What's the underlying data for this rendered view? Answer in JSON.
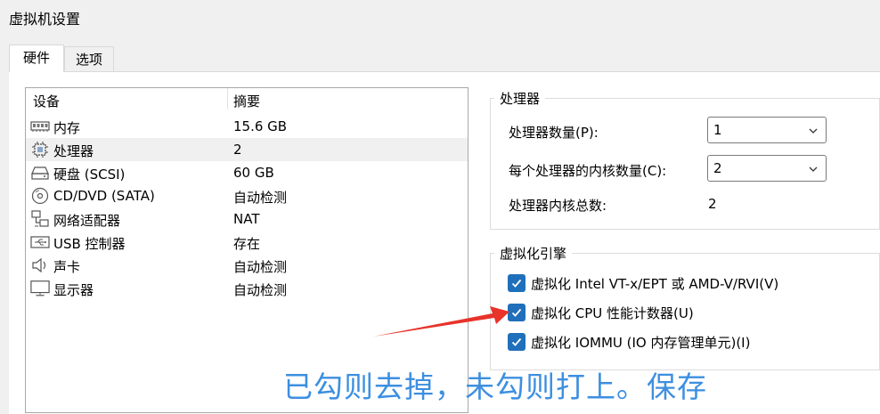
{
  "window": {
    "title": "虚拟机设置"
  },
  "tabs": [
    {
      "label": "硬件",
      "active": true
    },
    {
      "label": "选项",
      "active": false
    }
  ],
  "device_list": {
    "headers": {
      "device": "设备",
      "summary": "摘要"
    },
    "rows": [
      {
        "icon": "memory-icon",
        "name": "内存",
        "summary": "15.6 GB"
      },
      {
        "icon": "cpu-icon",
        "name": "处理器",
        "summary": "2",
        "selected": true
      },
      {
        "icon": "hard-disk-icon",
        "name": "硬盘 (SCSI)",
        "summary": "60 GB"
      },
      {
        "icon": "cd-dvd-icon",
        "name": "CD/DVD (SATA)",
        "summary": "自动检测"
      },
      {
        "icon": "network-adapter-icon",
        "name": "网络适配器",
        "summary": "NAT"
      },
      {
        "icon": "usb-icon",
        "name": "USB 控制器",
        "summary": "存在"
      },
      {
        "icon": "speaker-icon",
        "name": "声卡",
        "summary": "自动检测"
      },
      {
        "icon": "monitor-icon",
        "name": "显示器",
        "summary": "自动检测"
      }
    ]
  },
  "processors": {
    "legend": "处理器",
    "count_label": "处理器数量(P):",
    "count_value": "1",
    "cores_label": "每个处理器的内核数量(C):",
    "cores_value": "2",
    "total_label": "处理器内核总数:",
    "total_value": "2"
  },
  "virtualization": {
    "legend": "虚拟化引擎",
    "options": [
      {
        "label": "虚拟化 Intel VT-x/EPT 或 AMD-V/RVI(V)",
        "checked": true
      },
      {
        "label": "虚拟化 CPU 性能计数器(U)",
        "checked": true
      },
      {
        "label": "虚拟化 IOMMU (IO 内存管理单元)(I)",
        "checked": true
      }
    ]
  },
  "annotation": {
    "text": "已勾则去掉，未勾则打上。保存",
    "color": "#3d8fe0",
    "arrow_color": "#e8332a"
  },
  "colors": {
    "checkbox": "#1f6fba",
    "selected_row": "#f0f0f0"
  }
}
